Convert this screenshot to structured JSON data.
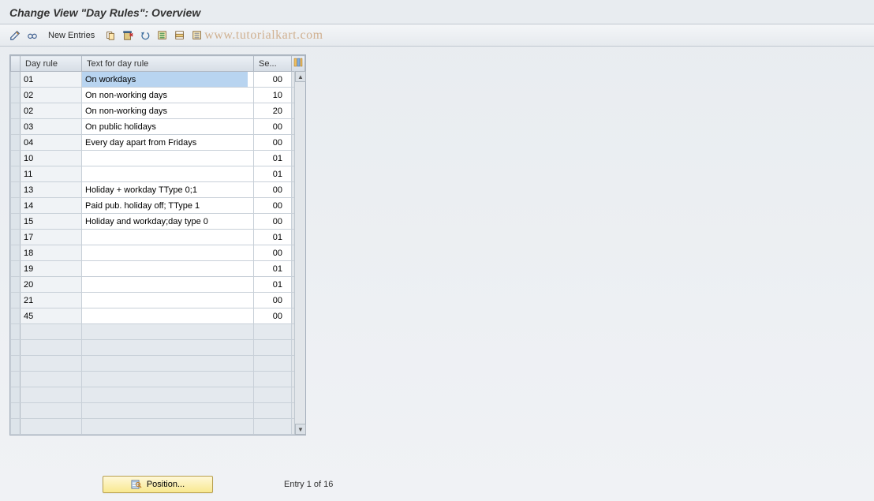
{
  "title": "Change View \"Day Rules\": Overview",
  "toolbar": {
    "new_entries_label": "New Entries"
  },
  "watermark": "www.tutorialkart.com",
  "table": {
    "headers": {
      "day_rule": "Day rule",
      "text": "Text for day rule",
      "se": "Se..."
    },
    "rows": [
      {
        "code": "01",
        "text": "On workdays",
        "se": "00",
        "selected": true
      },
      {
        "code": "02",
        "text": "On non-working days",
        "se": "10"
      },
      {
        "code": "02",
        "text": "On non-working days",
        "se": "20"
      },
      {
        "code": "03",
        "text": "On public holidays",
        "se": "00"
      },
      {
        "code": "04",
        "text": "Every day apart from Fridays",
        "se": "00"
      },
      {
        "code": "10",
        "text": "",
        "se": "01"
      },
      {
        "code": "11",
        "text": "",
        "se": "01"
      },
      {
        "code": "13",
        "text": "Holiday + workday TType 0;1",
        "se": "00"
      },
      {
        "code": "14",
        "text": "Paid pub. holiday off; TType 1",
        "se": "00"
      },
      {
        "code": "15",
        "text": "Holiday and workday;day type 0",
        "se": "00"
      },
      {
        "code": "17",
        "text": "",
        "se": "01"
      },
      {
        "code": "18",
        "text": "",
        "se": "00"
      },
      {
        "code": "19",
        "text": "",
        "se": "01"
      },
      {
        "code": "20",
        "text": "",
        "se": "01"
      },
      {
        "code": "21",
        "text": "",
        "se": "00"
      },
      {
        "code": "45",
        "text": "",
        "se": "00"
      }
    ],
    "empty_rows": 7
  },
  "footer": {
    "position_label": "Position...",
    "entry_text": "Entry 1 of 16"
  }
}
